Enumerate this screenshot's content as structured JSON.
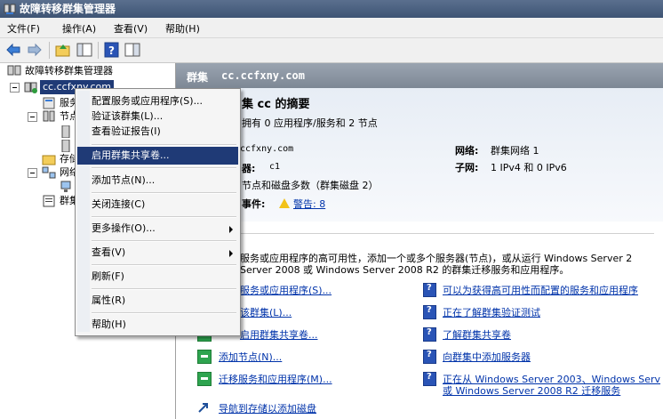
{
  "window": {
    "title": "故障转移群集管理器"
  },
  "menubar": [
    "文件(F)",
    "操作(A)",
    "查看(V)",
    "帮助(H)"
  ],
  "toolbar": [
    "back-icon",
    "forward-icon",
    "up-folder-icon",
    "show-hide-tree-icon",
    "help-icon",
    "properties-icon"
  ],
  "tree": {
    "root": "故障转移群集管理器",
    "cluster": "cc.ccfxny.com",
    "items": [
      "服务",
      "节点",
      "存储",
      "网络",
      "群集事件"
    ]
  },
  "header": {
    "label": "群集",
    "name": "cc.ccfxny.com"
  },
  "summary": {
    "title": "集 cc 的摘要",
    "subtitle": "拥有 0 应用程序/服务和 2 节点",
    "name_value": "ccfxny.com",
    "server_label": "器:",
    "server_value": "c1",
    "quorum": "节点和磁盘多数（群集磁盘 2）",
    "events_label": "事件:",
    "events_link": "警告: 8",
    "network_label": "网络:",
    "network_value": "群集网络 1",
    "subnet_label": "子网:",
    "subnet_value": "1 IPv4 和 0 IPv6"
  },
  "description": {
    "line1": "服务或应用程序的高可用性，添加一个或多个服务器(节点)，或从运行 Windows Server 2",
    "line2": "Server 2008 或 Windows Server 2008 R2 的群集迁移服务和应用程序。"
  },
  "actions": [
    "服务或应用程序(S)...",
    "该群集(L)...",
    "启用群集共享卷...",
    "添加节点(N)...",
    "迁移服务和应用程序(M)...",
    "导航到存储以添加磁盘"
  ],
  "help_links": [
    "可以为获得高可用性而配置的服务和应用程序",
    "正在了解群集验证测试",
    "了解群集共享卷",
    "向群集中添加服务器",
    "正在从 Windows Server 2003、Windows Serv",
    "或 Windows Server 2008 R2 迁移服务"
  ],
  "context_menu": [
    "配置服务或应用程序(S)...",
    "验证该群集(L)...",
    "查看验证报告(I)",
    "启用群集共享卷...",
    "添加节点(N)...",
    "关闭连接(C)",
    "更多操作(O)...",
    "查看(V)",
    "刷新(F)",
    "属性(R)",
    "帮助(H)"
  ],
  "colors": {
    "selection": "#1f3a76",
    "link": "#0033aa",
    "header": "#8b95a2"
  }
}
